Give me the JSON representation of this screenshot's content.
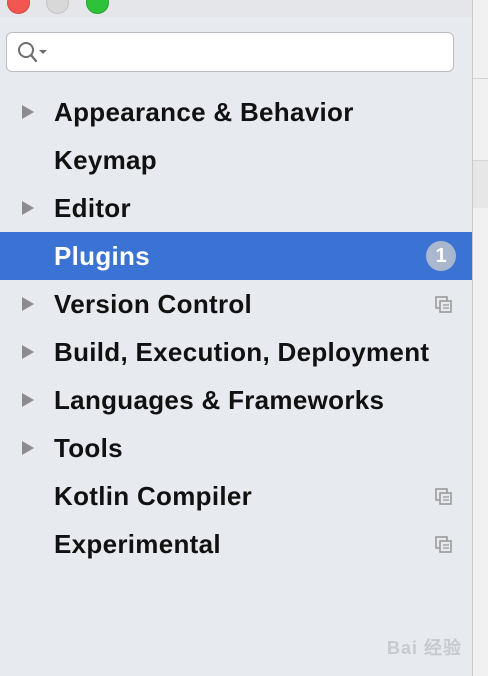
{
  "search": {
    "value": "",
    "placeholder": ""
  },
  "tree": {
    "items": [
      {
        "label": "Appearance & Behavior",
        "expandable": true
      },
      {
        "label": "Keymap",
        "expandable": false
      },
      {
        "label": "Editor",
        "expandable": true
      },
      {
        "label": "Plugins",
        "expandable": false,
        "selected": true,
        "badge": "1"
      },
      {
        "label": "Version Control",
        "expandable": true,
        "project_icon": "copy-icon"
      },
      {
        "label": "Build, Execution, Deployment",
        "expandable": true
      },
      {
        "label": "Languages & Frameworks",
        "expandable": true
      },
      {
        "label": "Tools",
        "expandable": true
      },
      {
        "label": "Kotlin Compiler",
        "expandable": false,
        "project_icon": "copy-icon"
      },
      {
        "label": "Experimental",
        "expandable": false,
        "project_icon": "copy-icon"
      }
    ]
  },
  "watermark": "Bai 经验",
  "colors": {
    "selection": "#3a73d3",
    "sidebar_bg": "#e7eaee",
    "badge": "#a9b7cf"
  }
}
